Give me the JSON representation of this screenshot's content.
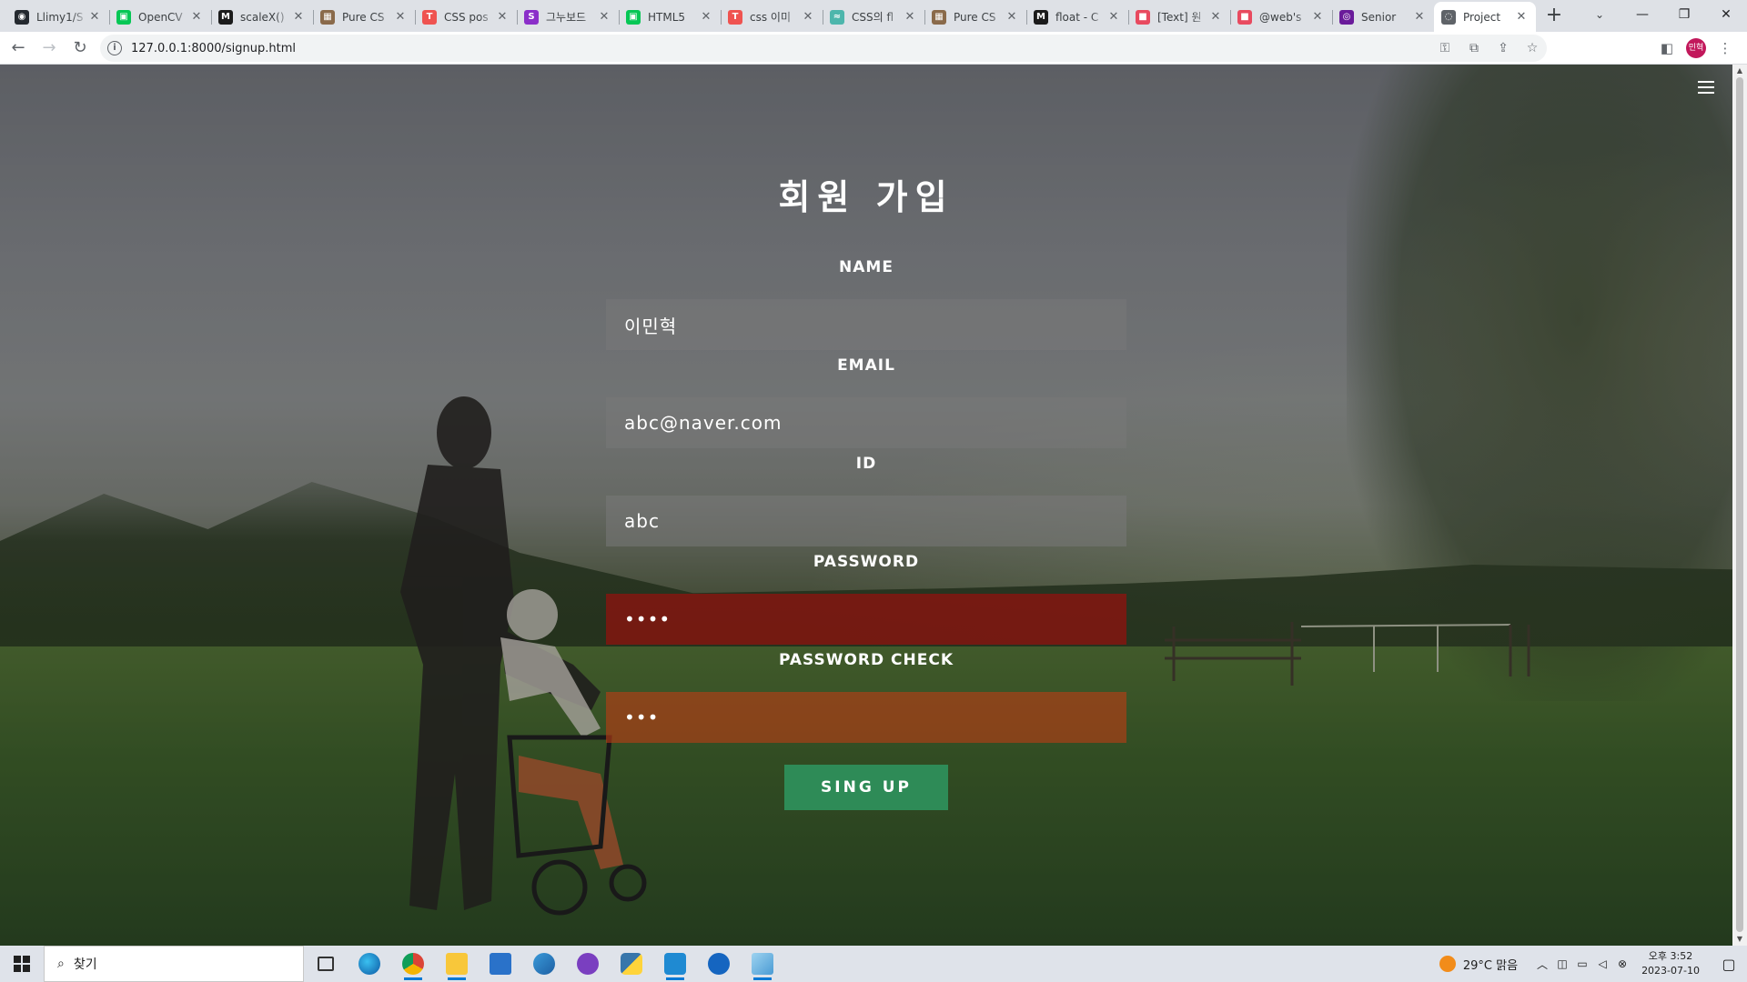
{
  "browser": {
    "tabs": [
      {
        "title": "Llimy1/S",
        "color": "#24292f",
        "glyph": "◉"
      },
      {
        "title": "OpenCV",
        "color": "#06c755",
        "glyph": "▣"
      },
      {
        "title": "scaleX()",
        "color": "#1b1b1b",
        "glyph": "M"
      },
      {
        "title": "Pure CS",
        "color": "#8a6a4a",
        "glyph": "▦"
      },
      {
        "title": "CSS pos",
        "color": "#ef5350",
        "glyph": "T"
      },
      {
        "title": "그누보드",
        "color": "#8b2fc9",
        "glyph": "S"
      },
      {
        "title": "HTML5",
        "color": "#06c755",
        "glyph": "▣"
      },
      {
        "title": "css 이미",
        "color": "#ef5350",
        "glyph": "T"
      },
      {
        "title": "CSS의 fl",
        "color": "#4db6ac",
        "glyph": "≈"
      },
      {
        "title": "Pure CS",
        "color": "#8a6a4a",
        "glyph": "▦"
      },
      {
        "title": "float - C",
        "color": "#1b1b1b",
        "glyph": "M"
      },
      {
        "title": "[Text] 원",
        "color": "#e84a5f",
        "glyph": "■"
      },
      {
        "title": "@web's",
        "color": "#e84a5f",
        "glyph": "■"
      },
      {
        "title": "Senior",
        "color": "#6a1b9a",
        "glyph": "◎"
      },
      {
        "title": "Project",
        "color": "#5f6368",
        "glyph": "◌"
      }
    ],
    "active_tab_index": 14,
    "new_tab": "+",
    "url": "127.0.0.1:8000/signup.html",
    "profile_initials": "민혁"
  },
  "page": {
    "title": "회원 가입",
    "fields": {
      "name_label": "NAME",
      "name_value": "이민혁",
      "email_label": "EMAIL",
      "email_value": "abc@naver.com",
      "id_label": "ID",
      "id_value": "abc",
      "password_label": "PASSWORD",
      "password_value": "••••",
      "password_check_label": "PASSWORD CHECK",
      "password_check_value": "•••"
    },
    "submit_label": "SING UP",
    "colors": {
      "submit": "#2e8b57",
      "password_error": "#aa0a0a",
      "password_check_error": "#be3c14"
    }
  },
  "taskbar": {
    "search_placeholder": "찾기",
    "weather": "29°C  맑음",
    "time": "오후 3:52",
    "date": "2023-07-10"
  }
}
